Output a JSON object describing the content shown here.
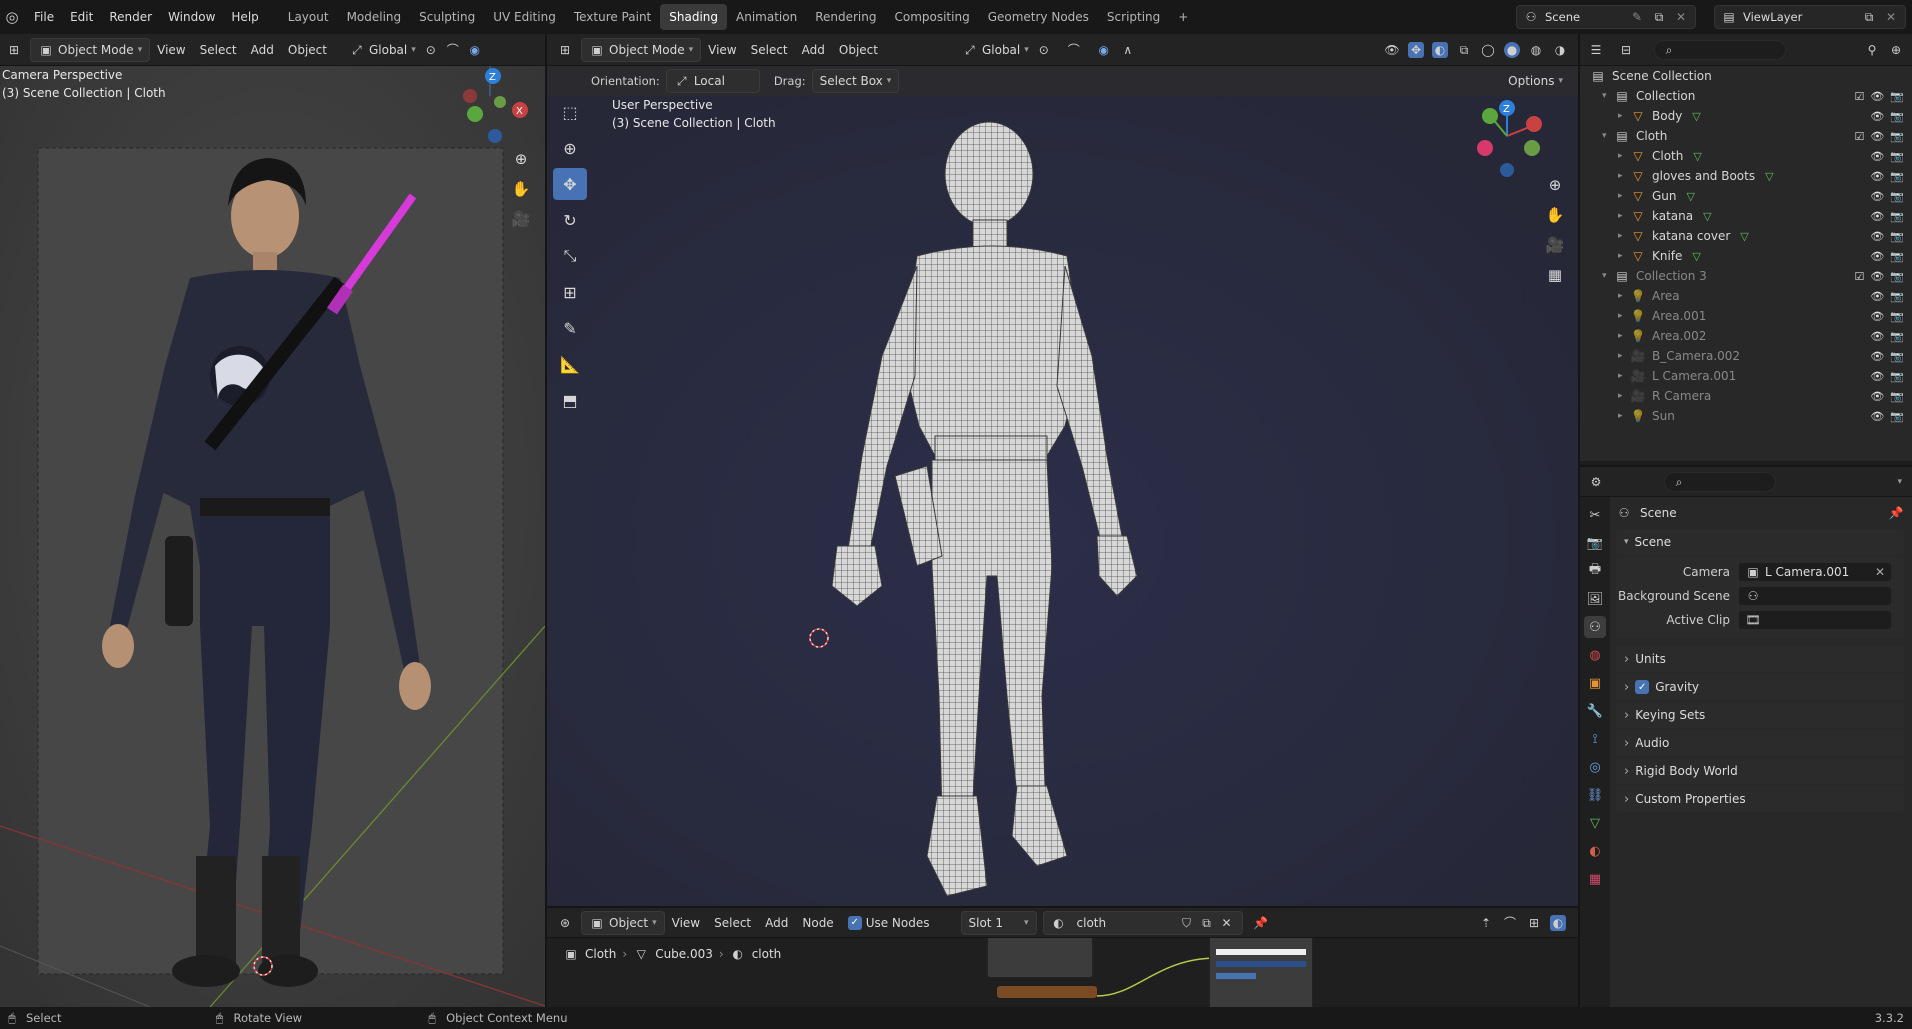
{
  "topbar": {
    "menus": [
      "File",
      "Edit",
      "Render",
      "Window",
      "Help"
    ],
    "workspaces": [
      "Layout",
      "Modeling",
      "Sculpting",
      "UV Editing",
      "Texture Paint",
      "Shading",
      "Animation",
      "Rendering",
      "Compositing",
      "Geometry Nodes",
      "Scripting"
    ],
    "active_workspace": "Shading",
    "add_tab": "+",
    "scene_name": "Scene",
    "view_layer": "ViewLayer"
  },
  "left_viewport": {
    "mode": "Object Mode",
    "menus": [
      "View",
      "Select",
      "Add",
      "Object"
    ],
    "orientation": "Global",
    "overlay_line1": "Camera Perspective",
    "overlay_line2": "(3) Scene Collection | Cloth"
  },
  "main_viewport": {
    "mode": "Object Mode",
    "menus": [
      "View",
      "Select",
      "Add",
      "Object"
    ],
    "orientation": "Global",
    "orientation_label": "Orientation:",
    "orientation_value": "Local",
    "drag_label": "Drag:",
    "drag_value": "Select Box",
    "options_label": "Options",
    "overlay_line1": "User Perspective",
    "overlay_line2": "(3) Scene Collection | Cloth"
  },
  "outliner": {
    "root": "Scene Collection",
    "items": [
      {
        "label": "Collection",
        "type": "collection",
        "depth": 1,
        "expanded": true,
        "dim": false
      },
      {
        "label": "Body",
        "type": "object",
        "depth": 2,
        "dim": false
      },
      {
        "label": "Cloth",
        "type": "collection",
        "depth": 1,
        "expanded": true,
        "dim": false
      },
      {
        "label": "Cloth",
        "type": "object",
        "depth": 2,
        "dim": false
      },
      {
        "label": "gloves and Boots",
        "type": "object",
        "depth": 2,
        "dim": false
      },
      {
        "label": "Gun",
        "type": "object",
        "depth": 2,
        "dim": false
      },
      {
        "label": "katana",
        "type": "object",
        "depth": 2,
        "dim": false
      },
      {
        "label": "katana cover",
        "type": "object",
        "depth": 2,
        "dim": false
      },
      {
        "label": "Knife",
        "type": "object",
        "depth": 2,
        "dim": false
      },
      {
        "label": "Collection 3",
        "type": "collection",
        "depth": 1,
        "expanded": true,
        "dim": true
      },
      {
        "label": "Area",
        "type": "light",
        "depth": 2,
        "dim": true
      },
      {
        "label": "Area.001",
        "type": "light",
        "depth": 2,
        "dim": true
      },
      {
        "label": "Area.002",
        "type": "light",
        "depth": 2,
        "dim": true
      },
      {
        "label": "B_Camera.002",
        "type": "camera",
        "depth": 2,
        "dim": true
      },
      {
        "label": "L Camera.001",
        "type": "camera",
        "depth": 2,
        "dim": true
      },
      {
        "label": "R Camera",
        "type": "camera",
        "depth": 2,
        "dim": true
      },
      {
        "label": "Sun",
        "type": "light",
        "depth": 2,
        "dim": true
      }
    ]
  },
  "properties": {
    "context": "Scene",
    "section": "Scene",
    "camera_label": "Camera",
    "camera_value": "L Camera.001",
    "bg_scene_label": "Background Scene",
    "active_clip_label": "Active Clip",
    "panels": [
      "Units",
      "Gravity",
      "Keying Sets",
      "Audio",
      "Rigid Body World",
      "Custom Properties"
    ],
    "gravity_checked": true
  },
  "node_editor": {
    "object_label": "Object",
    "menus": [
      "View",
      "Select",
      "Add",
      "Node"
    ],
    "use_nodes_label": "Use Nodes",
    "use_nodes_checked": true,
    "slot": "Slot 1",
    "material": "cloth",
    "breadcrumb": [
      "Cloth",
      "Cube.003",
      "cloth"
    ]
  },
  "statusbar": {
    "select": "Select",
    "rotate": "Rotate View",
    "context_menu": "Object Context Menu",
    "version": "3.3.2"
  },
  "colors": {
    "accent": "#4772b3",
    "object_orange": "#e8933a",
    "mesh_green": "#5fbf5f",
    "katana_magenta": "#d63ad8"
  },
  "icons": [
    "blender-logo-icon",
    "cursor-icon",
    "move-icon",
    "rotate-icon",
    "scale-icon",
    "transform-icon",
    "annotate-icon",
    "measure-icon",
    "add-cube-icon",
    "zoom-icon",
    "hand-icon",
    "camera-icon",
    "grid-icon",
    "eye-icon",
    "render-icon",
    "search-icon",
    "filter-icon",
    "pin-icon",
    "wrench-icon"
  ]
}
